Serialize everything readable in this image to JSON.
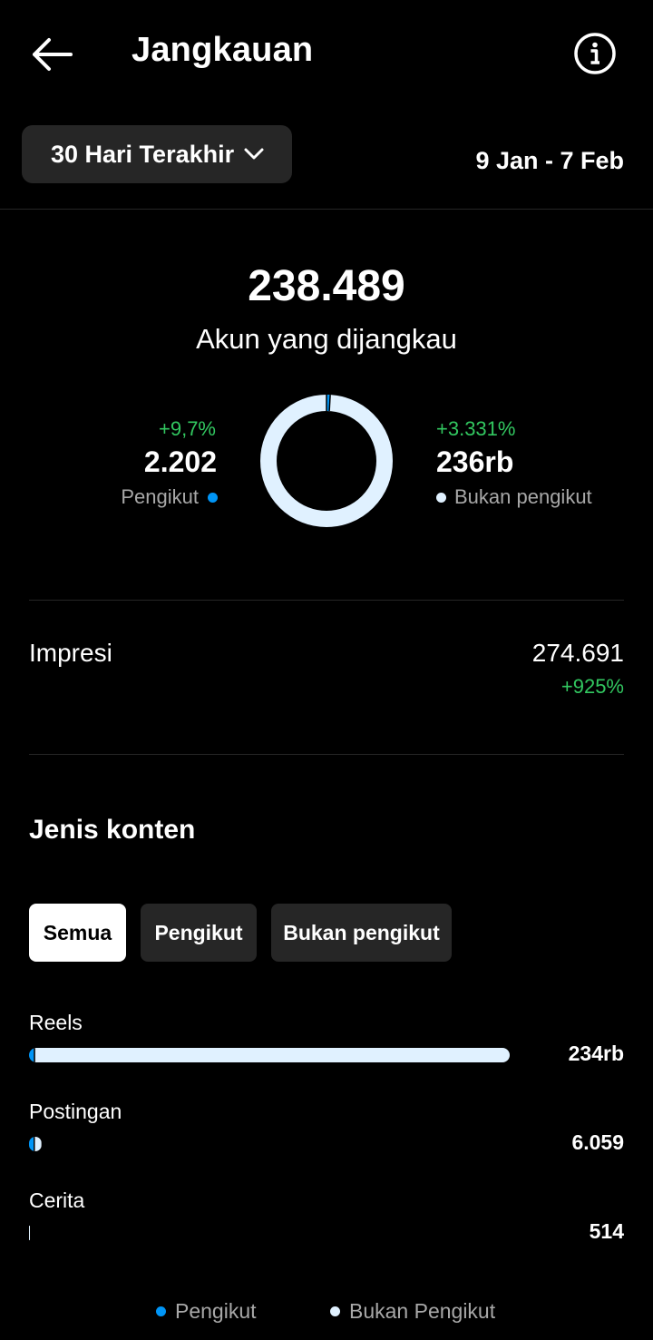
{
  "header": {
    "title": "Jangkauan",
    "back_icon": "arrow-left-icon",
    "info_icon": "info-circle-icon"
  },
  "filter": {
    "range_label": "30 Hari Terakhir",
    "dropdown_icon": "chevron-down-icon",
    "date_range": "9 Jan - 7 Feb"
  },
  "reach": {
    "total": "238.489",
    "total_label": "Akun yang dijangkau",
    "followers": {
      "change": "+9,7%",
      "value": "2.202",
      "label": "Pengikut",
      "color": "#0095f6",
      "share": 0.009
    },
    "non_followers": {
      "change": "+3.331%",
      "value": "236rb",
      "label": "Bukan pengikut",
      "color": "#e0f1ff",
      "share": 0.991
    }
  },
  "impressions": {
    "label": "Impresi",
    "value": "274.691",
    "change": "+925%"
  },
  "content_type": {
    "title": "Jenis konten",
    "tabs": [
      {
        "label": "Semua",
        "active": true
      },
      {
        "label": "Pengikut",
        "active": false
      },
      {
        "label": "Bukan pengikut",
        "active": false
      }
    ],
    "rows": [
      {
        "label": "Reels",
        "value": "234rb",
        "followers_fraction": 0.01,
        "total_fraction": 1.0
      },
      {
        "label": "Postingan",
        "value": "6.059",
        "followers_fraction": 0.35,
        "total_fraction": 0.026
      },
      {
        "label": "Cerita",
        "value": "514",
        "followers_fraction": 0.0,
        "total_fraction": 0.002
      }
    ],
    "legend": [
      {
        "label": "Pengikut",
        "color": "#0095f6"
      },
      {
        "label": "Bukan Pengikut",
        "color": "#e0f1ff"
      }
    ]
  }
}
